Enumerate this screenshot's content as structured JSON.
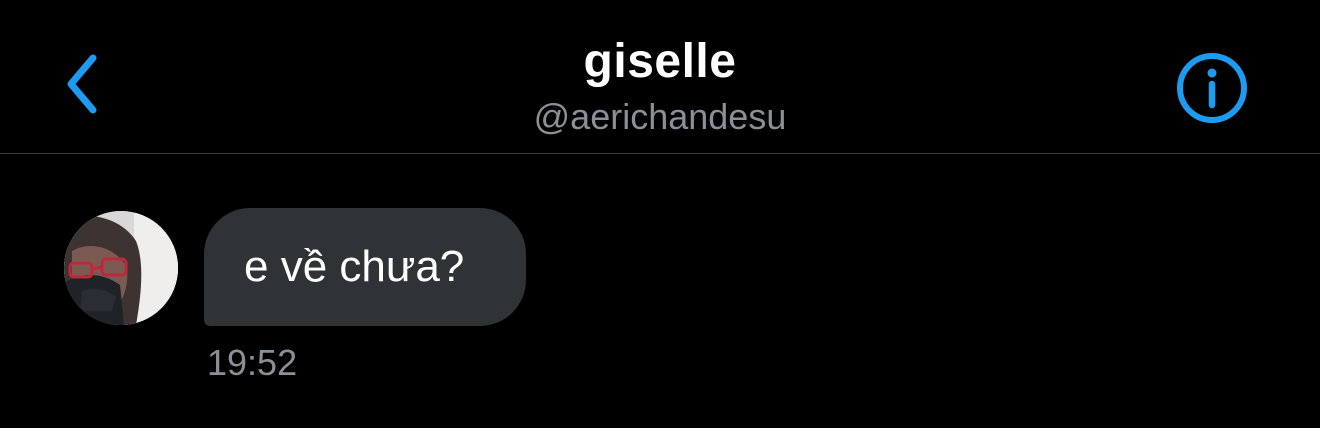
{
  "header": {
    "display_name": "giselle",
    "handle": "@aerichandesu",
    "back_icon": "chevron-left-icon",
    "info_icon": "info-icon"
  },
  "colors": {
    "accent": "#1d9bf0",
    "background": "#000000",
    "bubble": "#2f3336",
    "secondary_text": "#8b9096"
  },
  "conversation": {
    "messages": [
      {
        "text": "e về chưa?",
        "time": "19:52"
      }
    ]
  }
}
